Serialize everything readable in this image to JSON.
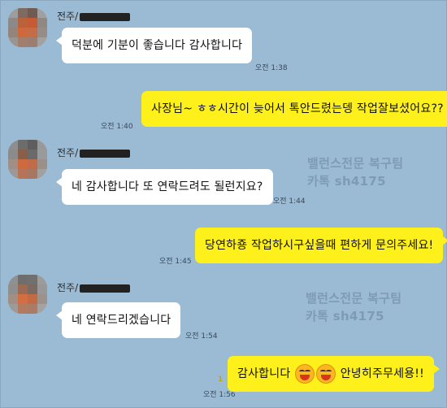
{
  "messages": [
    {
      "sender": "전주/",
      "text": "덕분에 기분이 좋습니다 감사합니다",
      "time": "오전 1:38"
    },
    {
      "text": "사장님~ ㅎㅎ시간이 늦어서 톡안드렸는뎅 작업잘보셨어요??",
      "time": "오전 1:40"
    },
    {
      "sender": "전주/",
      "text": "네 감사합니다 또 연락드려도 될런지요?",
      "time": "오전 1:44"
    },
    {
      "text": "당연하죵 작업하시구싶을때 편하게 문의주세요!",
      "time": "오전 1:45"
    },
    {
      "sender": "전주/",
      "text": "네 연락드리겠습니다",
      "time": "오전 1:54"
    },
    {
      "text_before": "감사합니다",
      "text_after": "안녕히주무세용!!",
      "time": "오전 1:56",
      "unread": "1",
      "emoji": [
        "grinning-face-icon",
        "grinning-face-icon"
      ]
    }
  ],
  "watermark": {
    "line1": "밸런스전문  복구팀",
    "line2": "카톡  sh4175"
  },
  "colors": {
    "background": "#9bbbd4",
    "my_bubble": "#fef01b",
    "their_bubble": "#ffffff"
  }
}
